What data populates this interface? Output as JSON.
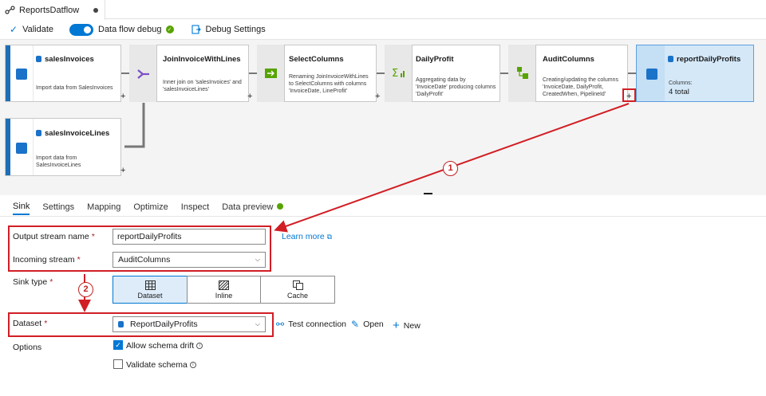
{
  "app": {
    "tab_title": "ReportsDatflow"
  },
  "toolbar": {
    "validate_label": "Validate",
    "debug_label": "Data flow debug",
    "debug_settings_label": "Debug Settings"
  },
  "nodes": {
    "sales_invoices": {
      "title": "salesInvoices",
      "desc": "Import data from SalesInvoices"
    },
    "join": {
      "title": "JoinInvoiceWithLines",
      "desc": "Inner join on 'salesInvoices' and 'salesInvoiceLines'"
    },
    "select": {
      "title": "SelectColumns",
      "desc": "Renaming JoinInvoiceWithLines to SelectColumns with columns 'InvoiceDate, LineProfit'"
    },
    "daily": {
      "title": "DailyProfit",
      "desc": "Aggregating data by 'InvoiceDate' producing columns 'DailyProfit'"
    },
    "audit": {
      "title": "AuditColumns",
      "desc": "Creating/updating the columns 'InvoiceDate, DailyProfit, CreatedWhen, PipelineId'"
    },
    "sink": {
      "title": "reportDailyProfits",
      "columns_label": "Columns:",
      "columns_value": "4 total"
    },
    "sales_lines": {
      "title": "salesInvoiceLines",
      "desc": "Import data from SalesInvoiceLines"
    }
  },
  "plus_glyph": "+",
  "tabs": [
    "Sink",
    "Settings",
    "Mapping",
    "Optimize",
    "Inspect",
    "Data preview"
  ],
  "form": {
    "output_stream_label": "Output stream name",
    "output_stream_value": "reportDailyProfits",
    "learn_more": "Learn more",
    "incoming_stream_label": "Incoming stream",
    "incoming_stream_value": "AuditColumns",
    "sink_type_label": "Sink type",
    "sink_types": [
      "Dataset",
      "Inline",
      "Cache"
    ],
    "dataset_label": "Dataset",
    "dataset_value": "ReportDailyProfits",
    "test_connection": "Test connection",
    "open": "Open",
    "new": "New",
    "options_label": "Options",
    "allow_schema_drift": "Allow schema drift",
    "validate_schema": "Validate schema",
    "required_mark": "*"
  },
  "annotations": {
    "callout_1": "1",
    "callout_2": "2"
  },
  "colors": {
    "accent": "#0078d4",
    "annotation_red": "#d11e25",
    "ok_green": "#57a300"
  },
  "icons": [
    "dataflow-icon",
    "validate-check-icon",
    "debug-settings-icon",
    "database-icon",
    "join-icon",
    "select-icon",
    "aggregate-icon",
    "derived-column-icon",
    "external-link-icon",
    "test-connection-icon",
    "edit-icon",
    "add-icon",
    "info-icon"
  ]
}
